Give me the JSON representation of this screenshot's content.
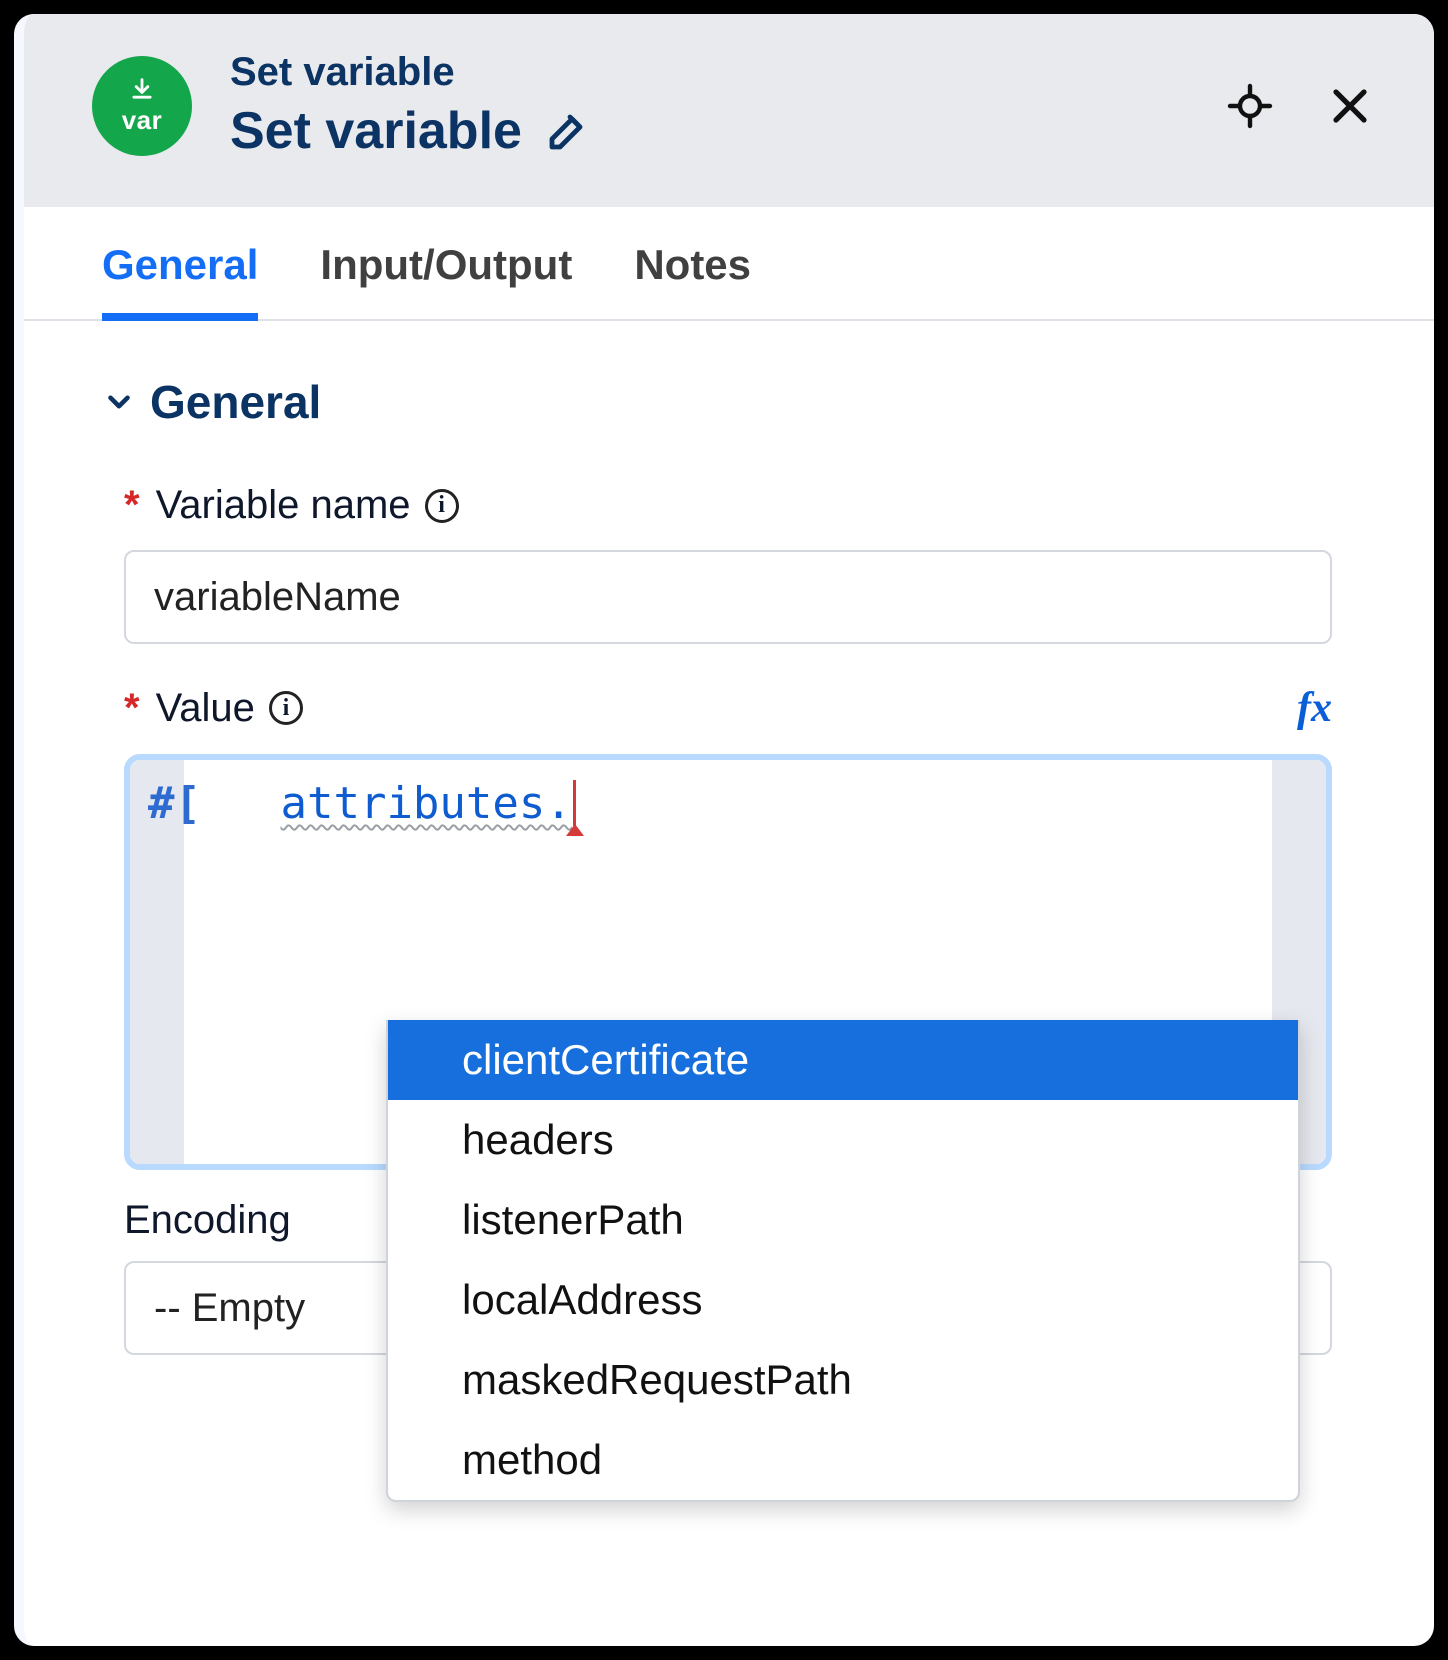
{
  "header": {
    "badge_text": "var",
    "subtitle": "Set variable",
    "title": "Set variable"
  },
  "tabs": [
    {
      "label": "General",
      "active": true
    },
    {
      "label": "Input/Output",
      "active": false
    },
    {
      "label": "Notes",
      "active": false
    }
  ],
  "section_title": "General",
  "fields": {
    "variable_name": {
      "label": "Variable name",
      "required": true,
      "value": "variableName"
    },
    "value": {
      "label": "Value",
      "required": true,
      "expression_prefix": "#[",
      "expression_identifier": "attributes.",
      "fx_label": "fx"
    },
    "encoding": {
      "label": "Encoding",
      "value": "-- Empty"
    }
  },
  "autocomplete": {
    "selected_index": 0,
    "items": [
      "clientCertificate",
      "headers",
      "listenerPath",
      "localAddress",
      "maskedRequestPath",
      "method"
    ]
  }
}
